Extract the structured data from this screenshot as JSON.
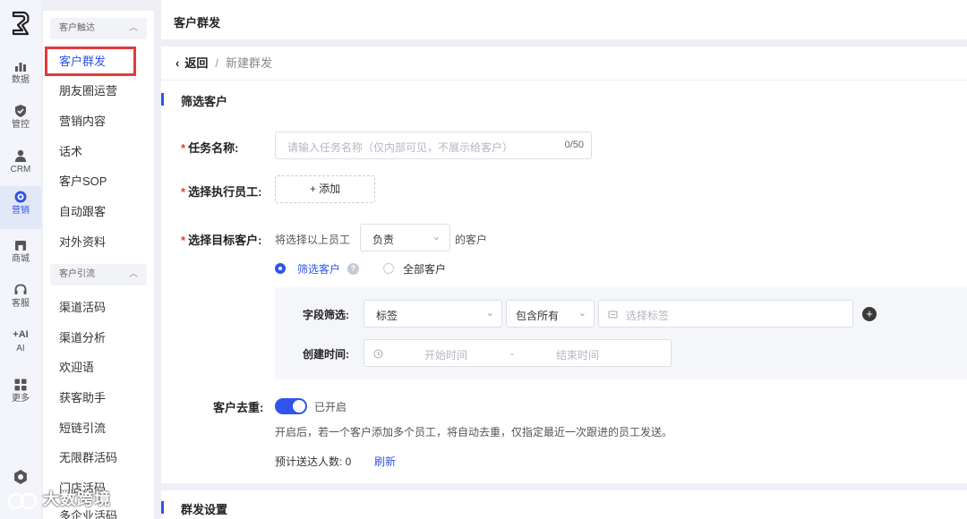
{
  "rail": {
    "items": [
      {
        "label": "数据",
        "icon": "bar-chart-icon"
      },
      {
        "label": "管控",
        "icon": "shield-check-icon"
      },
      {
        "label": "CRM",
        "icon": "user-icon"
      },
      {
        "label": "营销",
        "icon": "target-icon"
      },
      {
        "label": "商城",
        "icon": "shop-icon"
      },
      {
        "label": "客服",
        "icon": "headset-icon"
      },
      {
        "label": "AI",
        "icon": "ai-sparkle-icon",
        "prefix": "+AI"
      },
      {
        "label": "更多",
        "icon": "grid-icon"
      }
    ]
  },
  "submenu": {
    "group1": "客户触达",
    "group1_items": [
      "客户群发",
      "朋友圈运营",
      "营销内容",
      "话术",
      "客户SOP",
      "自动跟客",
      "对外资料"
    ],
    "group2": "客户引流",
    "group2_items": [
      "渠道活码",
      "渠道分析",
      "欢迎语",
      "获客助手",
      "短链引流",
      "无限群活码",
      "门店活码",
      "多企业活码"
    ]
  },
  "header": {
    "title": "客户群发"
  },
  "breadcrumb": {
    "back": "返回",
    "sep": "/",
    "current": "新建群发"
  },
  "section1": {
    "title": "筛选客户"
  },
  "form": {
    "task_name_label": "任务名称:",
    "task_name_placeholder": "请输入任务名称（仅内部可见，不展示给客户）",
    "task_name_count": "0/50",
    "staff_label": "选择执行员工:",
    "add_button": "+ 添加",
    "target_label": "选择目标客户:",
    "target_prefix": "将选择以上员工",
    "target_select": "负责",
    "target_suffix": "的客户",
    "radio_filter": "筛选客户",
    "radio_all": "全部客户",
    "field_filter_label": "字段筛选:",
    "field_select": "标签",
    "match_select": "包含所有",
    "tag_placeholder": "选择标签",
    "created_time_label": "创建时间:",
    "start_placeholder": "开始时间",
    "range_sep": "-",
    "end_placeholder": "结束时间",
    "dedupe_label": "客户去重:",
    "dedupe_state": "已开启",
    "dedupe_desc": "开启后，若一个客户添加多个员工，将自动去重，仅指定最近一次跟进的员工发送。",
    "estimate_label": "预计送达人数: 0",
    "refresh": "刷新"
  },
  "section2": {
    "title": "群发设置"
  },
  "watermark": {
    "text": "大数跨境"
  },
  "colors": {
    "primary": "#2f54eb",
    "required": "#e23a3a",
    "highlight_box": "#e23a3a"
  }
}
